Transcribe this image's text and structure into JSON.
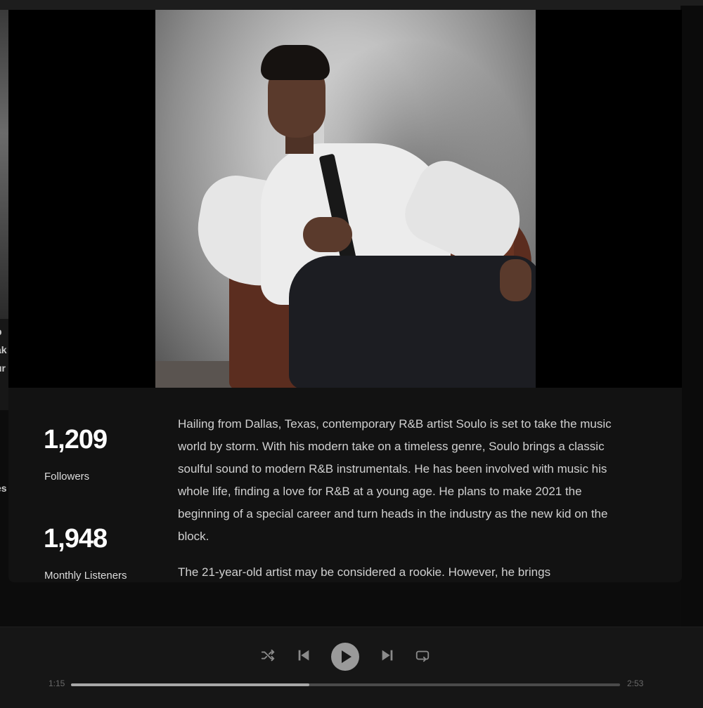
{
  "background_page": {
    "peek_lines": [
      "p",
      "ak",
      "ur",
      "es"
    ]
  },
  "artist": {
    "followers_count": "1,209",
    "followers_label": "Followers",
    "monthly_listeners_count": "1,948",
    "monthly_listeners_label": "Monthly Listeners",
    "bio_paragraphs": [
      "Hailing from Dallas, Texas, contemporary R&B artist Soulo is set to take the music world by storm. With his modern take on a timeless genre, Soulo brings a classic soulful sound to modern R&B instrumentals. He has been involved with music his whole life, finding a love for R&B at a young age. He plans to make 2021 the beginning of a special career and turn heads in the industry as the new kid on the block.",
      "The 21-year-old artist may be considered a rookie. However, he brings"
    ]
  },
  "player": {
    "shuffle_icon": "shuffle-icon",
    "previous_icon": "skip-back-icon",
    "play_icon": "play-icon",
    "next_icon": "skip-forward-icon",
    "repeat_icon": "repeat-icon",
    "elapsed": "1:15",
    "duration": "2:53",
    "progress": 0.434
  },
  "colors": {
    "background": "#121212",
    "text_primary": "#ffffff",
    "text_secondary": "#d0d0d0",
    "player_bg": "#161616"
  }
}
